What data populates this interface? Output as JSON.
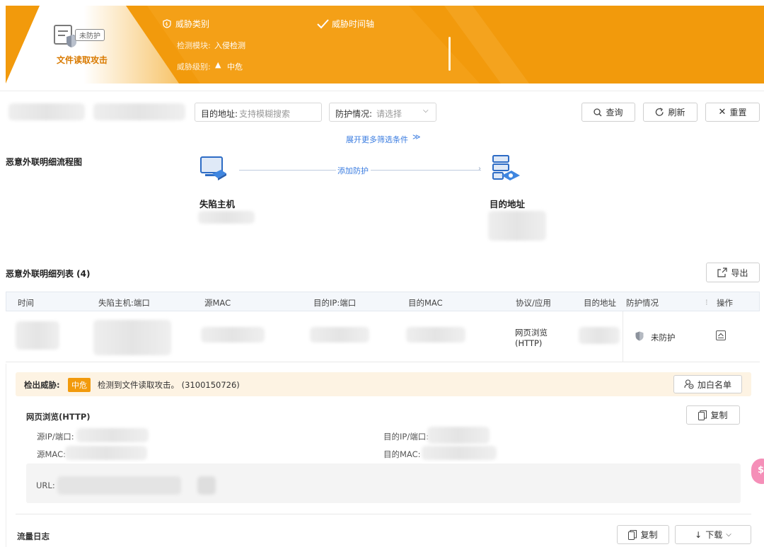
{
  "banner": {
    "status_badge": "未防护",
    "attack_title": "文件读取攻击",
    "threat_type_label": "威胁类别",
    "module_label": "检测模块:",
    "module_value": "入侵检测",
    "level_label": "威胁级别:",
    "level_value": "中危",
    "timeline_label": "威胁时间轴"
  },
  "filters": {
    "dest_label": "目的地址:",
    "dest_placeholder": "支持模糊搜索",
    "protect_label": "防护情况:",
    "protect_placeholder": "请选择",
    "query_btn": "查询",
    "refresh_btn": "刷新",
    "reset_btn": "重置",
    "expand_link": "展开更多筛选条件"
  },
  "flow": {
    "title": "恶意外联明细流程图",
    "mid_label": "添加防护",
    "host_label": "失陷主机",
    "dest_label": "目的地址"
  },
  "list": {
    "title": "恶意外联明细列表 (4)",
    "export_btn": "导出",
    "columns": [
      "时间",
      "失陷主机:端口",
      "源MAC",
      "目的IP:端口",
      "目的MAC",
      "协议/应用",
      "目的地址",
      "防护情况",
      "操作"
    ],
    "row": {
      "protocol_line1": "网页浏览",
      "protocol_line2": "(HTTP)",
      "protect_status": "未防护"
    }
  },
  "detail": {
    "detect_label": "检出威胁:",
    "level_tag": "中危",
    "detect_text": "检测到文件读取攻击。 (3100150726)",
    "whitelist_btn": "加白名单",
    "section_title": "网页浏览(HTTP)",
    "copy_btn": "复制",
    "src_ip_label": "源IP/端口:",
    "dst_ip_label": "目的IP/端口:",
    "src_mac_label": "源MAC:",
    "dst_mac_label": "目的MAC:",
    "url_label": "URL:",
    "log_title": "流量日志",
    "copy_btn2": "复制",
    "download_btn": "下载"
  },
  "colors": {
    "brand": "#f29a0c",
    "link": "#3a7ce0"
  }
}
